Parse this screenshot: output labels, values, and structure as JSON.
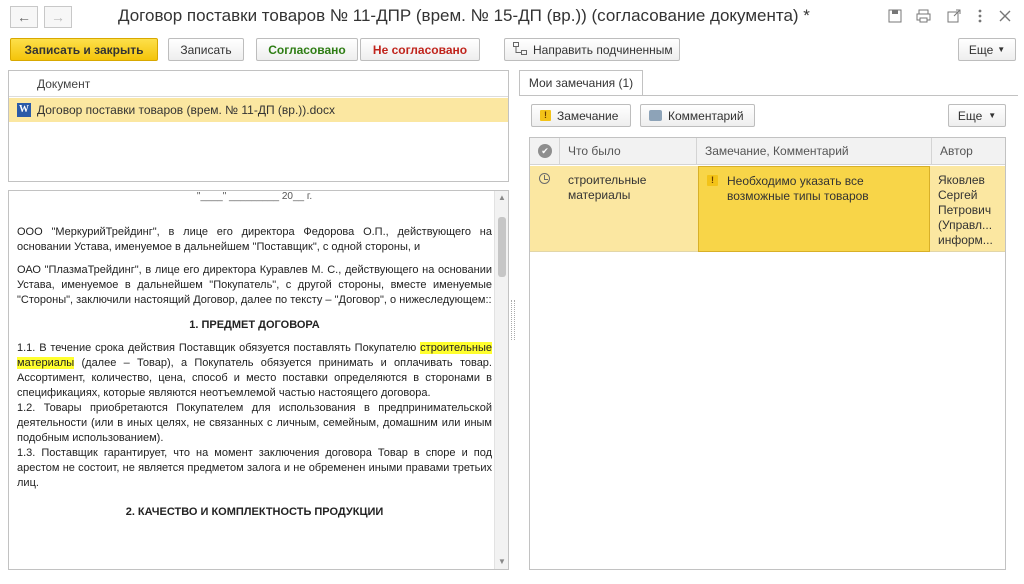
{
  "window": {
    "title": "Договор поставки товаров  № 11-ДПР (врем. № 15-ДП (вр.)) (согласование документа) *",
    "back_glyph": "←",
    "forward_glyph": "→"
  },
  "toolbar": {
    "save_close": "Записать и закрыть",
    "save": "Записать",
    "approved": "Согласовано",
    "not_approved": "Не согласовано",
    "send_subordinates": "Направить подчиненным",
    "more": "Еще"
  },
  "document_list": {
    "header": "Документ",
    "row": "Договор поставки товаров (врем. № 11-ДП (вр.)).docx",
    "icon_letter": "W"
  },
  "document_text": {
    "top_fragment": "\"____\" _________ 20__ г.",
    "para1": "ООО \"МеркурийТрейдинг\", в лице его директора Федорова О.П., действующего на основании Устава, именуемое в дальнейшем \"Поставщик\", с одной стороны, и",
    "para2": "ОАО \"ПлазмаТрейдинг\", в лице его директора Куравлев М. С., действующего на основании Устава, именуемое в дальнейшем \"Покупатель\", с другой стороны, вместе именуемые \"Стороны\", заключили настоящий Договор,  далее по тексту – \"Договор\",  о нижеследующем::",
    "section1": "1. ПРЕДМЕТ ДОГОВОРА",
    "p11_a": "1.1. В течение срока действия Поставщик обязуется поставлять Покупателю ",
    "p11_hl1": "строительные",
    "p11_hl2": "материалы",
    "p11_b": " (далее – Товар), а Покупатель обязуется принимать и оплачивать товар. Ассортимент, количество, цена, способ и место поставки определяются в сторонами в спецификациях, которые являются неотъемлемой частью настоящего договора.",
    "p12": "1.2. Товары приобретаются Покупателем для использования в предпринимательской деятельности (или в иных целях, не связанных с личным, семейным, домашним или иным подобным использованием).",
    "p13": "1.3. Поставщик гарантирует, что на момент заключения договора Товар в споре и под арестом не состоит, не является предметом залога и не обременен иными правами третьих лиц.",
    "section2": "2. КАЧЕСТВО И КОМПЛЕКТНОСТЬ ПРОДУКЦИИ"
  },
  "remarks": {
    "tab_label": "Мои замечания (1)",
    "btn_remark": "Замечание",
    "btn_comment": "Комментарий",
    "more": "Еще",
    "columns": [
      "Что было",
      "Замечание, Комментарий",
      "Автор"
    ],
    "rows": [
      {
        "was": "строительные материалы",
        "remark": "Необходимо указать все возможные типы товаров",
        "author": "Яковлев Сергей Петрович (Управл... информ..."
      }
    ]
  }
}
